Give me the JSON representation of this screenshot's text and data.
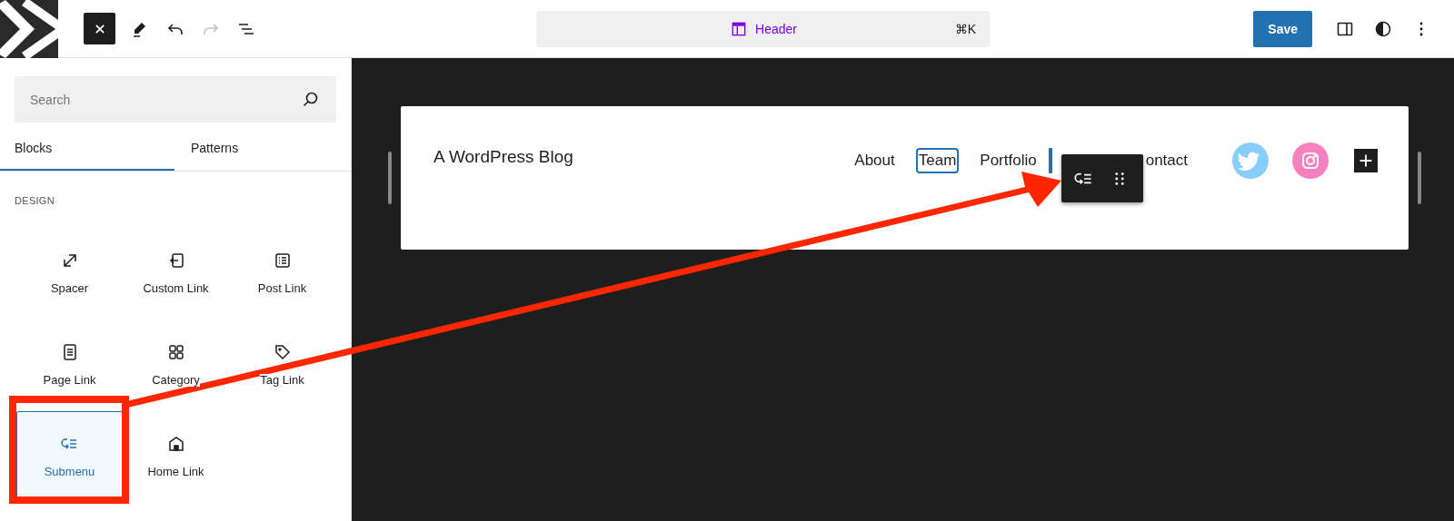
{
  "top_bar": {
    "command_center": {
      "title": "Header",
      "shortcut": "⌘K"
    },
    "save_label": "Save",
    "redo_disabled": true
  },
  "sidebar": {
    "search": {
      "placeholder": "Search"
    },
    "tabs": [
      {
        "label": "Blocks",
        "selected": true
      },
      {
        "label": "Patterns",
        "selected": false
      }
    ],
    "category": "DESIGN",
    "blocks": [
      {
        "label": "Spacer",
        "kind": "spacer",
        "selected": false
      },
      {
        "label": "Custom Link",
        "kind": "custom-link",
        "selected": false
      },
      {
        "label": "Post Link",
        "kind": "post-link",
        "selected": false
      },
      {
        "label": "Page Link",
        "kind": "page-link",
        "selected": false
      },
      {
        "label": "Category",
        "kind": "category",
        "selected": false
      },
      {
        "label": "Tag Link",
        "kind": "tag",
        "selected": false
      },
      {
        "label": "Submenu",
        "kind": "submenu",
        "selected": true
      },
      {
        "label": "Home Link",
        "kind": "home",
        "selected": false
      }
    ]
  },
  "canvas": {
    "site_title": "A WordPress Blog",
    "nav_items": [
      {
        "label": "About",
        "selected": false
      },
      {
        "label": "Team",
        "selected": true
      },
      {
        "label": "Portfolio",
        "selected": false
      }
    ],
    "after_toolbar_item": "ontact",
    "social_icons": [
      {
        "kind": "twitter",
        "color": "#87cefa"
      },
      {
        "kind": "instagram",
        "color": "#f780c0"
      }
    ]
  }
}
